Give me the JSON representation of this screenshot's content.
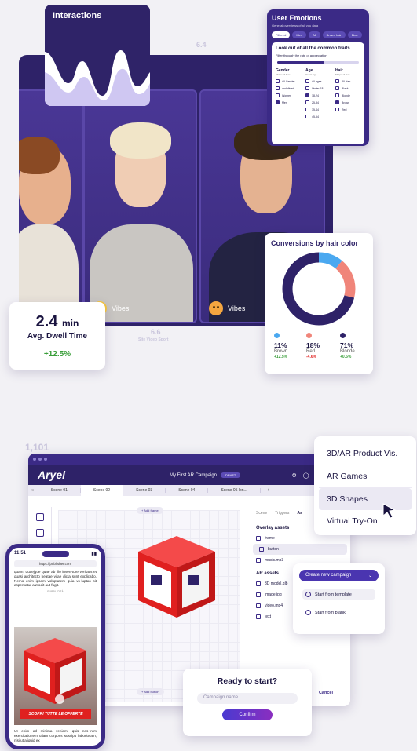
{
  "top": {
    "ghost_value_1": "6.4",
    "ghost_value_2": "6.6",
    "ghost_sub": "Site Video Sport",
    "interactions": {
      "title": "Interactions"
    },
    "vibes": [
      {
        "label": "Vibes"
      },
      {
        "label": "Vibes"
      }
    ],
    "user_emotions": {
      "title": "User Emotions",
      "subtitle": "General overviews of all you data",
      "chips": [
        "Filtered",
        "Men",
        "All",
        "Brown hair",
        "Blue"
      ],
      "panel_title": "Look out of all the common traits",
      "panel_sub": "Filter through the rate of appreciation",
      "slider_value": 0.58,
      "columns": [
        {
          "title": "Gender",
          "sub": "Shape of face",
          "options": [
            "All Gender",
            "undefined",
            "Women",
            "Men"
          ],
          "checked": [
            false,
            false,
            false,
            true
          ]
        },
        {
          "title": "Age",
          "sub": "User's age",
          "options": [
            "All ages",
            "Under 18",
            "18-24",
            "25-34",
            "35-44",
            "45-54"
          ],
          "checked": [
            false,
            false,
            true,
            false,
            false,
            false
          ]
        },
        {
          "title": "Hair",
          "sub": "Shape of face",
          "options": [
            "All Hair",
            "Black",
            "Blonde",
            "Brown",
            "Red"
          ],
          "checked": [
            false,
            false,
            false,
            true,
            false
          ]
        }
      ]
    },
    "conversions": {
      "title": "Conversions by hair color",
      "items": [
        {
          "pct": "11%",
          "name": "Brown",
          "delta": "+12.5%",
          "delta_color": "#3a9e3a",
          "color": "#4aa8f0"
        },
        {
          "pct": "18%",
          "name": "Red",
          "delta": "-4.6%",
          "delta_color": "#e0201f",
          "color": "#f0857a"
        },
        {
          "pct": "71%",
          "name": "Blonde",
          "delta": "+0.5%",
          "delta_color": "#3a9e3a",
          "color": "#2e2268"
        }
      ]
    },
    "dwell": {
      "value": "2.4",
      "unit": "min",
      "label": "Avg. Dwell Time",
      "delta": "+12.5%"
    }
  },
  "bottom": {
    "ghost_value": "1,101",
    "editor": {
      "logo": "Aryel",
      "campaign_name": "My First AR Campaign",
      "status": "DRAFT",
      "scenes": [
        "Scene 01",
        "Scene 02",
        "Scene 03",
        "Scene 04",
        "Scene 05 lon..."
      ],
      "add_frame": "+ Add frame",
      "add_button": "+ Add button",
      "tabs": [
        "Scene",
        "Triggers",
        "As"
      ],
      "overlay_title": "Overlay assets",
      "overlay_items": [
        "frame",
        "button",
        "music.mp3"
      ],
      "ar_title": "AR assets",
      "ar_items": [
        "3D model.glb",
        "image.jpg",
        "video.mp4",
        "text"
      ],
      "cancel": "Cancel"
    },
    "phone": {
      "time": "11:51",
      "url": "https://publisher.com",
      "text_top": "quam, quaejque quae ab illo inven-tore veritatis et quasi architecto beatae vitae dicta sunt explicabo. Nemo enim ipsam voluptatem quia vo-luptas sit aspernatur aut odit aut fugit.",
      "publicita": "PUBBLICITÀ",
      "ad_banner": "SCOPRI TUTTE LE OFFERTE",
      "text_bottom": "Ut enim ad minima veniam, quis nos-trum exercitationem ullam corporis suscipit laboriosam, nisi ut aliquid ex"
    },
    "product_menu": {
      "items": [
        "3D/AR Product Vis.",
        "AR Games",
        "3D Shapes",
        "Virtual Try-On"
      ],
      "highlighted": 2
    },
    "create": {
      "button": "Create new campaign",
      "options": [
        "Start from template",
        "Start from blank"
      ]
    },
    "ready": {
      "title": "Ready to start?",
      "placeholder": "Campaign name",
      "confirm": "Confirm"
    }
  }
}
